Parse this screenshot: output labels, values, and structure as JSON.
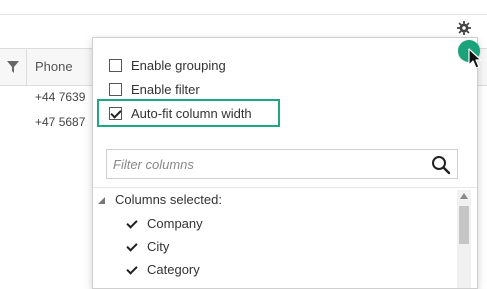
{
  "grid": {
    "phone_header": "Phone",
    "rows": [
      {
        "phone": "+44 7639"
      },
      {
        "phone": "+47 5687"
      }
    ]
  },
  "icons": {
    "gear": "gear-icon",
    "filter": "funnel-icon",
    "search": "magnifier-icon",
    "cursor": "mouse-pointer-icon"
  },
  "colors": {
    "accent": "#21a582",
    "click_indicator": "#1aa37a"
  },
  "popup": {
    "options": [
      {
        "label": "Enable grouping",
        "checked": false
      },
      {
        "label": "Enable filter",
        "checked": false
      },
      {
        "label": "Auto-fit column width",
        "checked": true
      }
    ],
    "filter_placeholder": "Filter columns",
    "section_label": "Columns selected:",
    "columns": [
      {
        "label": "Company",
        "checked": true
      },
      {
        "label": "City",
        "checked": true
      },
      {
        "label": "Category",
        "checked": true
      }
    ]
  }
}
